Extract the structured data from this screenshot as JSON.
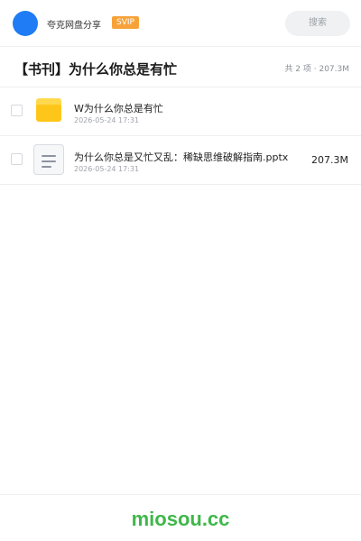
{
  "topbar": {
    "account_name": "夸克网盘分享",
    "badge": "SVIP",
    "search_placeholder": "搜索",
    "avatar_color": "#1f7cf4",
    "badge_color": "#f7a239"
  },
  "header": {
    "title": "【书刊】为什么你总是有忙",
    "summary": "共 2 项 · 207.3M"
  },
  "files": [
    {
      "name": "W为什么你总是有忙",
      "date": "2026-05-24 17:31",
      "size": "",
      "icon": "folder-icon",
      "checked": false
    },
    {
      "name": "为什么你总是又忙又乱：稀缺思维破解指南.pptx",
      "date": "2026-05-24 17:31",
      "size": "207.3M",
      "icon": "document-icon",
      "checked": false
    }
  ],
  "footer": {
    "watermark": "miosou.cc",
    "watermark_color": "#3fb74a"
  }
}
